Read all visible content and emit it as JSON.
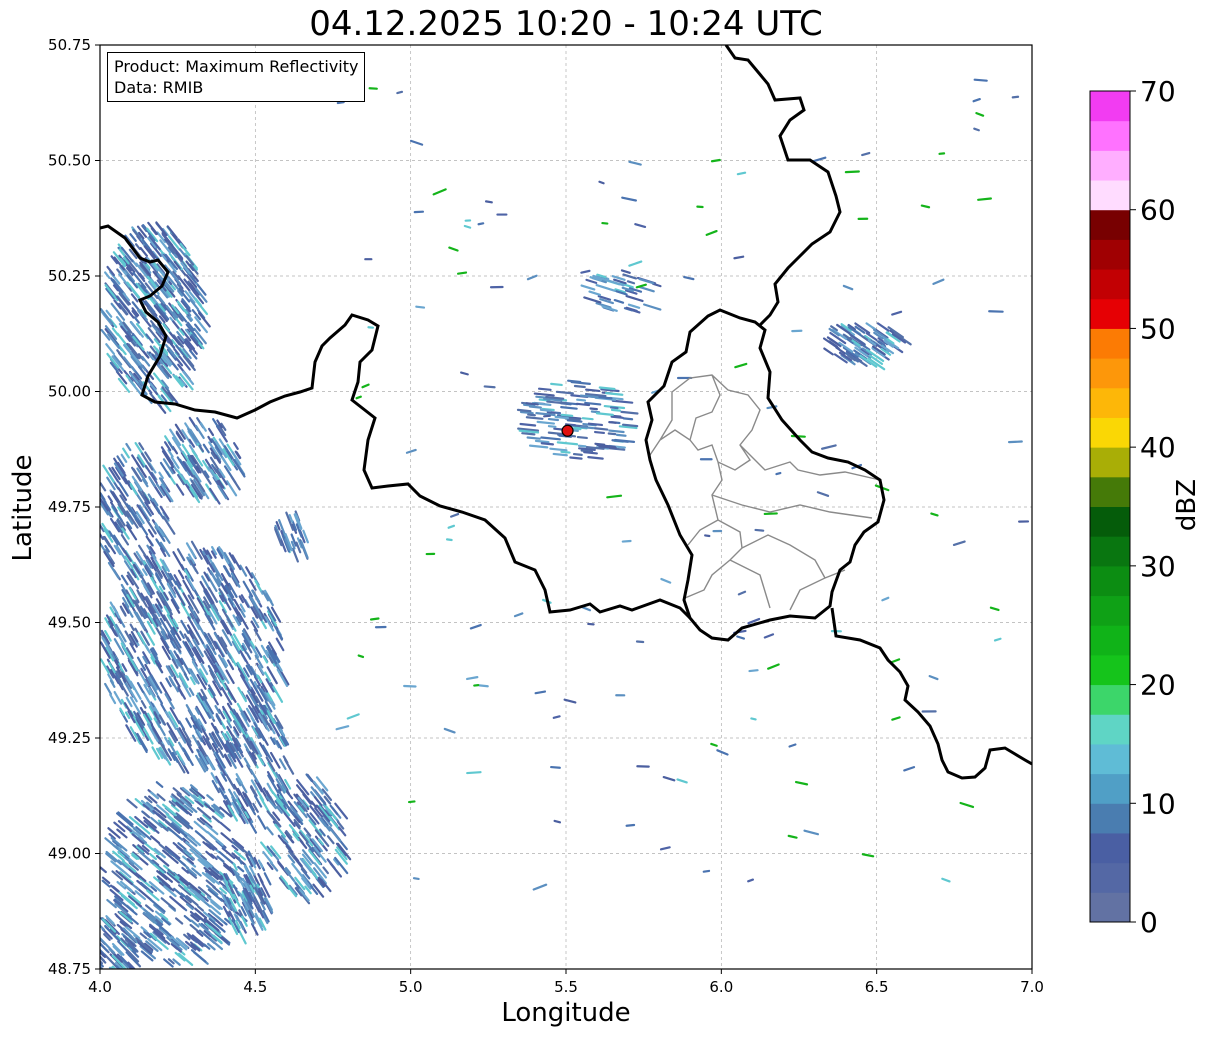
{
  "title": "04.12.2025 10:20 - 10:24 UTC",
  "info_box": {
    "line1": "Product: Maximum Reflectivity",
    "line2": "Data: RMIB"
  },
  "map": {
    "xlabel": "Longitude",
    "ylabel": "Latitude",
    "xlim": [
      4.0,
      7.0
    ],
    "ylim": [
      48.75,
      50.75
    ],
    "xticks": [
      "4.0",
      "4.5",
      "5.0",
      "5.5",
      "6.0",
      "6.5",
      "7.0"
    ],
    "yticks": [
      "48.75",
      "49.00",
      "49.25",
      "49.50",
      "49.75",
      "50.00",
      "50.25",
      "50.50",
      "50.75"
    ],
    "grid": true,
    "radar_site": {
      "lon": 5.505,
      "lat": 49.915
    }
  },
  "colorbar": {
    "label": "dBZ",
    "min": 0,
    "max": 70,
    "ticks": [
      "0",
      "10",
      "20",
      "30",
      "40",
      "50",
      "60",
      "70"
    ],
    "colors": [
      "#6272a3",
      "#5468a5",
      "#4a5fa3",
      "#4a7db0",
      "#509fc6",
      "#5fbcd6",
      "#5fd5c5",
      "#3cd66a",
      "#15c41b",
      "#10b318",
      "#0fa116",
      "#0c8d12",
      "#097610",
      "#055c0a",
      "#457a08",
      "#a9ae06",
      "#fad705",
      "#fdb708",
      "#fd970a",
      "#fc7b04",
      "#e60004",
      "#c20003",
      "#a00002",
      "#780001",
      "#ffdcff",
      "#ffaeff",
      "#ff72ff",
      "#f23cf2"
    ]
  }
}
